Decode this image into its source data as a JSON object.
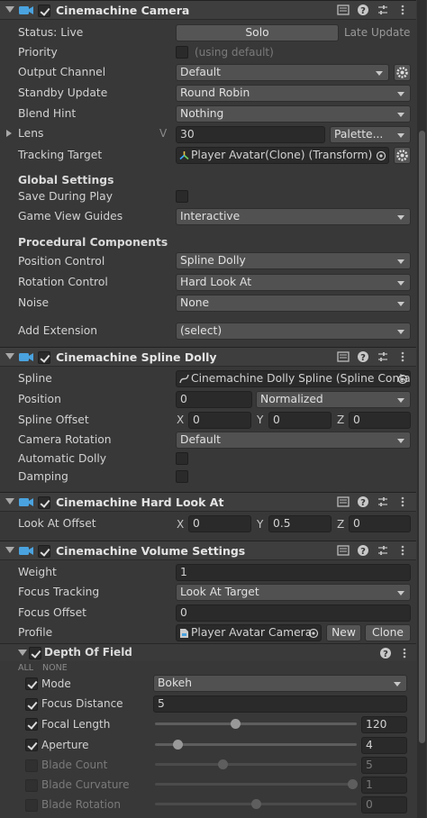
{
  "camera": {
    "title": "Cinemachine Camera",
    "status_label": "Status: Live",
    "solo_label": "Solo",
    "late_update": "Late Update",
    "priority_label": "Priority",
    "priority_hint": "(using default)",
    "output_channel_label": "Output Channel",
    "output_channel_value": "Default",
    "standby_label": "Standby Update",
    "standby_value": "Round Robin",
    "blend_hint_label": "Blend Hint",
    "blend_hint_value": "Nothing",
    "lens_label": "Lens",
    "lens_v": "V",
    "lens_value": "30",
    "palette_label": "Palette...",
    "tracking_label": "Tracking Target",
    "tracking_value": "Player Avatar(Clone) (Transform)",
    "global_settings": "Global Settings",
    "save_play_label": "Save During Play",
    "guides_label": "Game View Guides",
    "guides_value": "Interactive",
    "procedural": "Procedural Components",
    "position_control_label": "Position Control",
    "position_control_value": "Spline Dolly",
    "rotation_control_label": "Rotation Control",
    "rotation_control_value": "Hard Look At",
    "noise_label": "Noise",
    "noise_value": "None",
    "add_extension_label": "Add Extension",
    "add_extension_value": "(select)"
  },
  "dolly": {
    "title": "Cinemachine Spline Dolly",
    "spline_label": "Spline",
    "spline_value": "Cinemachine Dolly Spline (Spline Conta",
    "position_label": "Position",
    "position_value": "0",
    "position_units": "Normalized",
    "offset_label": "Spline Offset",
    "x_label": "X",
    "x_value": "0",
    "y_label": "Y",
    "y_value": "0",
    "z_label": "Z",
    "z_value": "0",
    "camrot_label": "Camera Rotation",
    "camrot_value": "Default",
    "autodolly_label": "Automatic Dolly",
    "damping_label": "Damping"
  },
  "lookat": {
    "title": "Cinemachine Hard Look At",
    "offset_label": "Look At Offset",
    "x_label": "X",
    "x_value": "0",
    "y_label": "Y",
    "y_value": "0.5",
    "z_label": "Z",
    "z_value": "0"
  },
  "volume": {
    "title": "Cinemachine Volume Settings",
    "weight_label": "Weight",
    "weight_value": "1",
    "focus_tracking_label": "Focus Tracking",
    "focus_tracking_value": "Look At Target",
    "focus_offset_label": "Focus Offset",
    "focus_offset_value": "0",
    "profile_label": "Profile",
    "profile_value": "Player Avatar Camera",
    "new_label": "New",
    "clone_label": "Clone"
  },
  "dof": {
    "title": "Depth Of Field",
    "all_label": "ALL",
    "none_label": "NONE",
    "mode_label": "Mode",
    "mode_value": "Bokeh",
    "focus_distance_label": "Focus Distance",
    "focus_distance_value": "5",
    "focal_length_label": "Focal Length",
    "focal_length_value": "120",
    "aperture_label": "Aperture",
    "aperture_value": "4",
    "blade_count_label": "Blade Count",
    "blade_count_value": "5",
    "blade_curvature_label": "Blade Curvature",
    "blade_curvature_value": "1",
    "blade_rotation_label": "Blade Rotation",
    "blade_rotation_value": "0"
  }
}
